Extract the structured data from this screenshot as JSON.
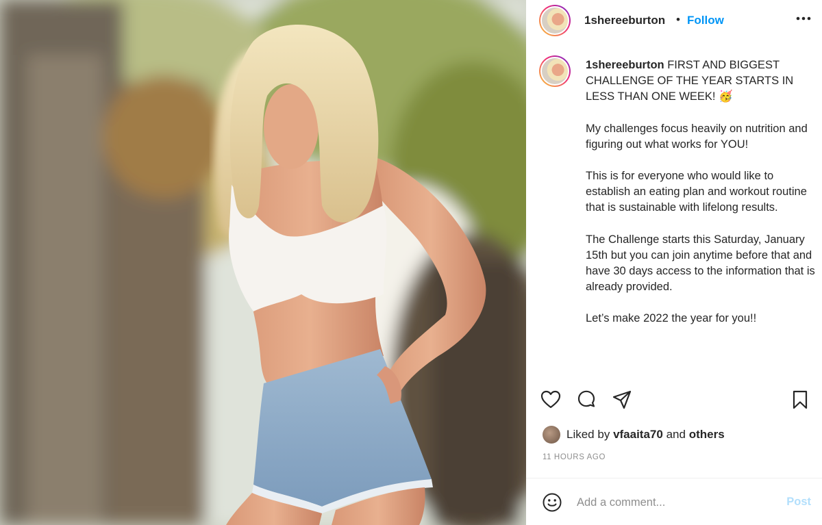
{
  "post": {
    "username": "1shereeburton",
    "separator": "•",
    "follow_label": "Follow",
    "caption": {
      "username": "1shereeburton",
      "intro": "FIRST AND BIGGEST CHALLENGE OF THE YEAR STARTS IN LESS THAN ONE WEEK! 🥳",
      "paragraphs": [
        "My challenges focus heavily on nutrition and figuring out what works for YOU!",
        "This is for everyone who would like to establish an eating plan and workout routine that is sustainable with lifelong results.",
        "The Challenge starts this Saturday, January 15th but you can join anytime before that and have 30 days access to the information that is already provided.",
        "Let’s make 2022 the year for you!!"
      ]
    },
    "likes": {
      "prefix": "Liked by",
      "user": "vfaaita70",
      "joiner": "and",
      "others": "others"
    },
    "timestamp": "11 HOURS AGO",
    "comment": {
      "placeholder": "Add a comment...",
      "post_label": "Post"
    },
    "icons": {
      "more": "more-options-icon",
      "like": "heart-icon",
      "comment": "comment-icon",
      "share": "share-icon",
      "save": "bookmark-icon",
      "emoji": "emoji-icon"
    },
    "colors": {
      "follow": "#0095f6",
      "post_disabled": "#b2dffc",
      "meta_text": "#8e8e8e",
      "text": "#262626"
    }
  }
}
